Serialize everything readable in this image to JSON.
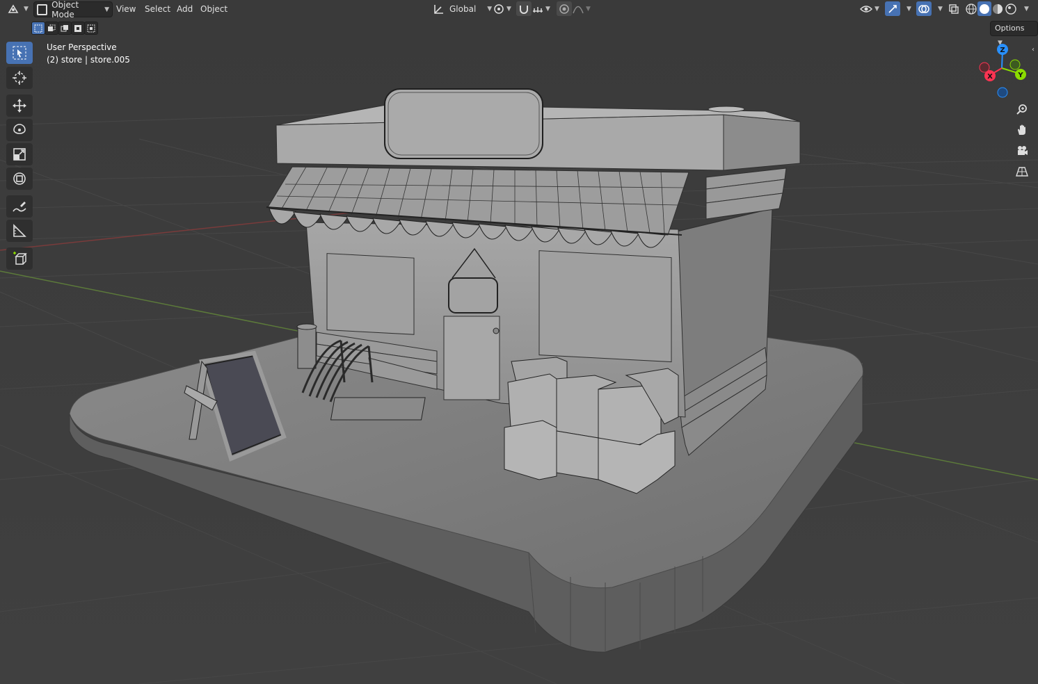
{
  "header": {
    "editor_type_icon": "viewport-editor-icon",
    "mode": "Object Mode",
    "menus": [
      "View",
      "Select",
      "Add",
      "Object"
    ],
    "transform_orientation": "Global",
    "options_label": "Options"
  },
  "overlay": {
    "view_name": "User Perspective",
    "object_info": "(2) store | store.005"
  },
  "gizmo": {
    "z": "Z",
    "y": "Y",
    "x": "X"
  },
  "colors": {
    "accent": "#4772b3",
    "x_axis": "#ff3352",
    "y_axis": "#8bdc00",
    "z_axis": "#2890ff",
    "viewport_bg": "#3d3d3d",
    "grid_line": "#4a4a4a",
    "model_gray": "#9a9a9a"
  },
  "tools": [
    {
      "name": "select-box-icon"
    },
    {
      "name": "cursor-icon"
    },
    {
      "name": "move-icon"
    },
    {
      "name": "rotate-icon"
    },
    {
      "name": "scale-icon"
    },
    {
      "name": "transform-icon"
    },
    {
      "name": "annotate-icon"
    },
    {
      "name": "measure-icon"
    },
    {
      "name": "add-cube-icon"
    }
  ]
}
